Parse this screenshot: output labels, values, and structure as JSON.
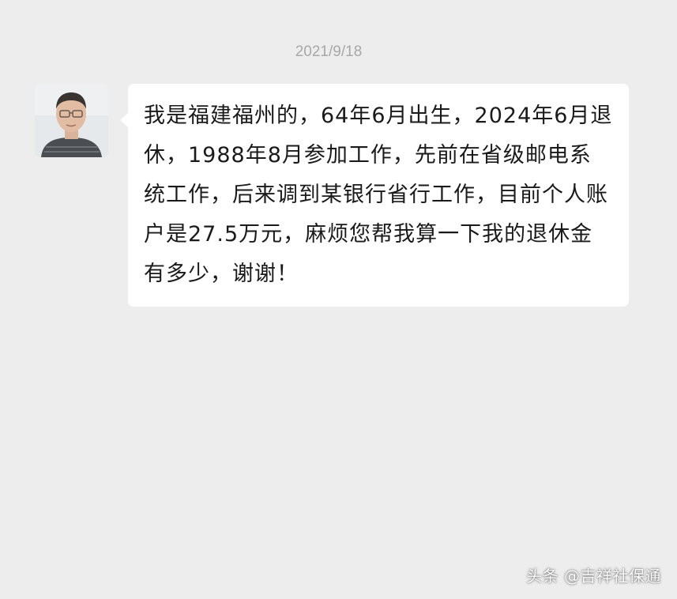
{
  "chat": {
    "timestamp": "2021/9/18",
    "messages": [
      {
        "sender_avatar": "avatar-man-glasses",
        "text": "我是福建福州的，64年6月出生，2024年6月退休，1988年8月参加工作，先前在省级邮电系统工作，后来调到某银行省行工作，目前个人账户是27.5万元，麻烦您帮我算一下我的退休金有多少，谢谢！"
      }
    ]
  },
  "watermark": {
    "text": "头条 @吉祥社保通"
  },
  "colors": {
    "background": "#ededed",
    "bubble": "#ffffff",
    "timestamp": "#a8a8a8",
    "message_text": "#1a1a1a"
  }
}
